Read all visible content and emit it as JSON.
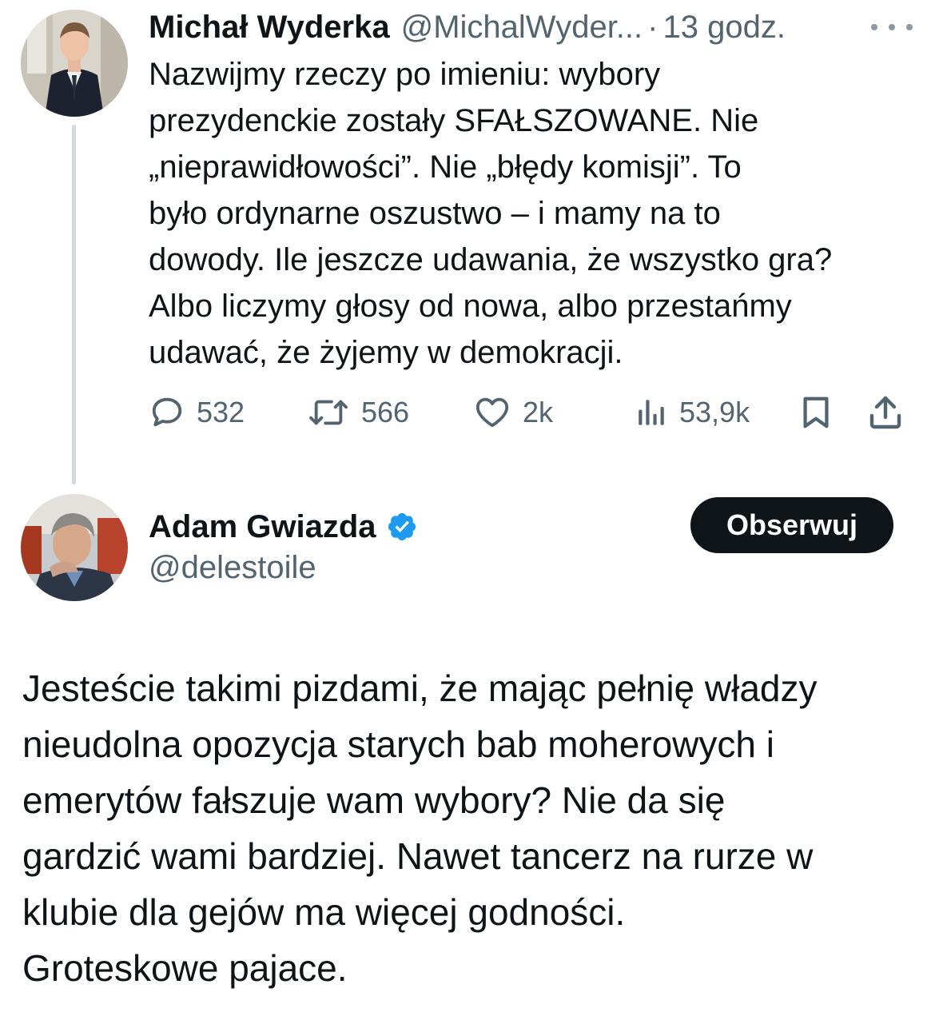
{
  "parent_tweet": {
    "author_name": "Michał Wyderka",
    "handle": "@MichalWyder...",
    "separator": "·",
    "time": "13 godz.",
    "text_lines": [
      "Nazwijmy rzeczy po imieniu: wybory",
      "prezydenckie zostały SFAŁSZOWANE. Nie",
      "„nieprawidłowości”. Nie „błędy komisji”. To",
      "było ordynarne oszustwo – i mamy na to",
      "dowody. Ile jeszcze udawania, że wszystko gra?",
      "Albo liczymy głosy od nowa, albo przestańmy",
      "udawać, że żyjemy w demokracji."
    ],
    "stats": {
      "replies": "532",
      "reposts": "566",
      "likes": "2k",
      "views": "53,9k"
    },
    "icons": [
      "reply-icon",
      "repost-icon",
      "like-icon",
      "views-icon",
      "bookmark-icon",
      "share-icon",
      "more-icon"
    ]
  },
  "reply_tweet": {
    "author_name": "Adam Gwiazda",
    "handle": "@delestoile",
    "follow_label": "Obserwuj",
    "text_lines": [
      "Jesteście takimi pizdami, że mając pełnię władzy",
      "nieudolna opozycja starych bab moherowych i",
      "emerytów fałszuje wam wybory? Nie da się",
      "gardzić wami bardziej. Nawet tancerz na rurze w",
      "klubie dla gejów ma więcej godności.",
      "Groteskowe pajace."
    ],
    "icons": [
      "verified-icon"
    ]
  },
  "colors": {
    "text_primary": "#0f1419",
    "text_secondary": "#536471",
    "verified_blue": "#1d9bf0",
    "thread_line": "#cfd9de"
  }
}
